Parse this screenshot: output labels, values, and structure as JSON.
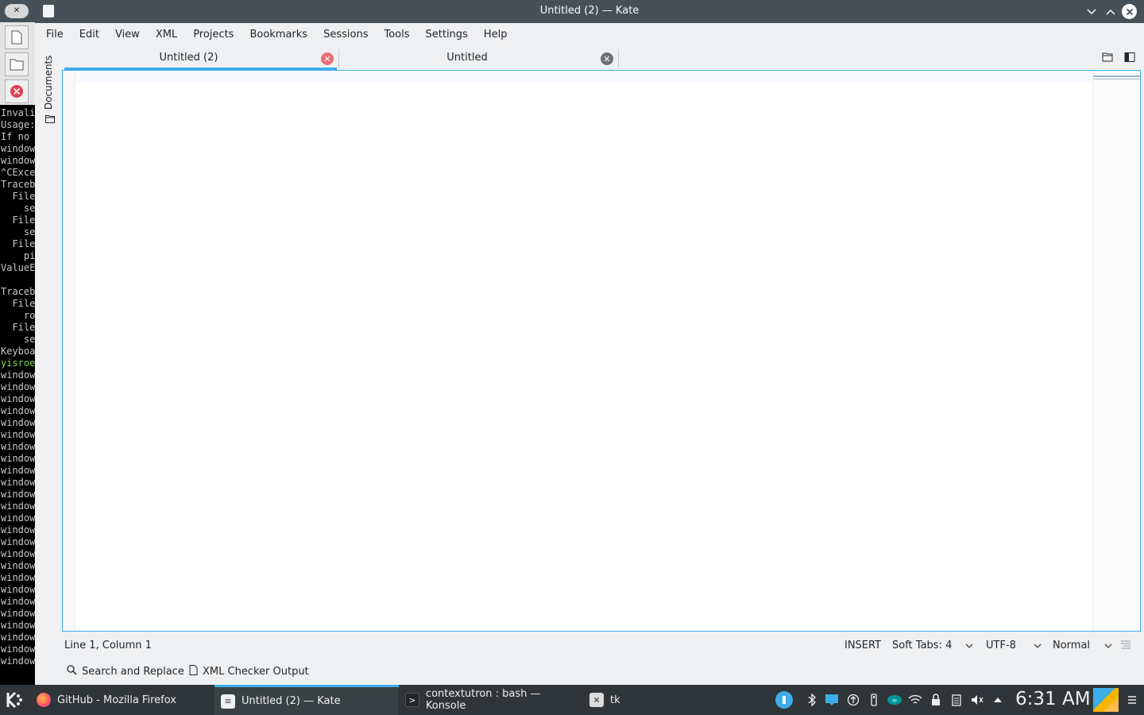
{
  "window": {
    "title": "Untitled (2) — Kate"
  },
  "menubar": [
    "File",
    "Edit",
    "View",
    "XML",
    "Projects",
    "Bookmarks",
    "Sessions",
    "Tools",
    "Settings",
    "Help"
  ],
  "side_panel": {
    "documents_label": "Documents"
  },
  "tabs": [
    {
      "label": "Untitled (2)",
      "active": true
    },
    {
      "label": "Untitled",
      "active": false
    }
  ],
  "statusbar": {
    "position": "Line 1, Column 1",
    "mode": "INSERT",
    "indent": "Soft Tabs: 4",
    "encoding": "UTF-8",
    "highlighting": "Normal"
  },
  "toolviews": {
    "search_replace": "Search and Replace",
    "xml_checker": "XML Checker Output"
  },
  "terminal_lines": [
    {
      "text": "Invali",
      "color": "gray"
    },
    {
      "text": "Usage:",
      "color": "gray"
    },
    {
      "text": "If no",
      "color": "gray"
    },
    {
      "text": "window",
      "color": "gray"
    },
    {
      "text": "window",
      "color": "gray"
    },
    {
      "text": "^CExce",
      "color": "gray"
    },
    {
      "text": "Traceb",
      "color": "gray"
    },
    {
      "text": "  File",
      "color": "gray"
    },
    {
      "text": "    se",
      "color": "gray"
    },
    {
      "text": "  File",
      "color": "gray"
    },
    {
      "text": "    se",
      "color": "gray"
    },
    {
      "text": "  File",
      "color": "gray"
    },
    {
      "text": "    pi",
      "color": "gray"
    },
    {
      "text": "ValueE",
      "color": "gray"
    },
    {
      "text": "",
      "color": "gray"
    },
    {
      "text": "Traceb",
      "color": "gray"
    },
    {
      "text": "  File",
      "color": "gray"
    },
    {
      "text": "    ro",
      "color": "gray"
    },
    {
      "text": "  File",
      "color": "gray"
    },
    {
      "text": "    se",
      "color": "gray"
    },
    {
      "text": "Keyboa",
      "color": "gray"
    },
    {
      "text": "yisroe",
      "color": "green"
    },
    {
      "text": "window",
      "color": "gray"
    },
    {
      "text": "window",
      "color": "gray"
    },
    {
      "text": "window",
      "color": "gray"
    },
    {
      "text": "window",
      "color": "gray"
    },
    {
      "text": "window",
      "color": "gray"
    },
    {
      "text": "window",
      "color": "gray"
    },
    {
      "text": "window",
      "color": "gray"
    },
    {
      "text": "window",
      "color": "gray"
    },
    {
      "text": "window",
      "color": "gray"
    },
    {
      "text": "window",
      "color": "gray"
    },
    {
      "text": "window",
      "color": "gray"
    },
    {
      "text": "window",
      "color": "gray"
    },
    {
      "text": "window",
      "color": "gray"
    },
    {
      "text": "window",
      "color": "gray"
    },
    {
      "text": "window",
      "color": "gray"
    },
    {
      "text": "window",
      "color": "gray"
    },
    {
      "text": "window",
      "color": "gray"
    },
    {
      "text": "window",
      "color": "gray"
    },
    {
      "text": "window",
      "color": "gray"
    },
    {
      "text": "window",
      "color": "gray"
    },
    {
      "text": "window",
      "color": "gray"
    },
    {
      "text": "window",
      "color": "gray"
    },
    {
      "text": "window",
      "color": "gray"
    },
    {
      "text": "window",
      "color": "gray"
    },
    {
      "text": "window",
      "color": "gray"
    }
  ],
  "taskbar": {
    "tasks": [
      {
        "label": "GitHub - Mozilla Firefox",
        "icon": "firefox-icon",
        "active": false
      },
      {
        "label": "Untitled (2)  — Kate",
        "icon": "kate-icon",
        "active": true
      },
      {
        "label": "contextutron : bash — Konsole",
        "icon": "konsole-icon",
        "active": false
      },
      {
        "label": "tk",
        "icon": "tk-icon",
        "active": false
      }
    ],
    "clock": "6:31 AM"
  },
  "colors": {
    "accent": "#3daee9",
    "titlebar": "#475057",
    "taskbar": "#2f3538",
    "close_red": "#da4453"
  }
}
